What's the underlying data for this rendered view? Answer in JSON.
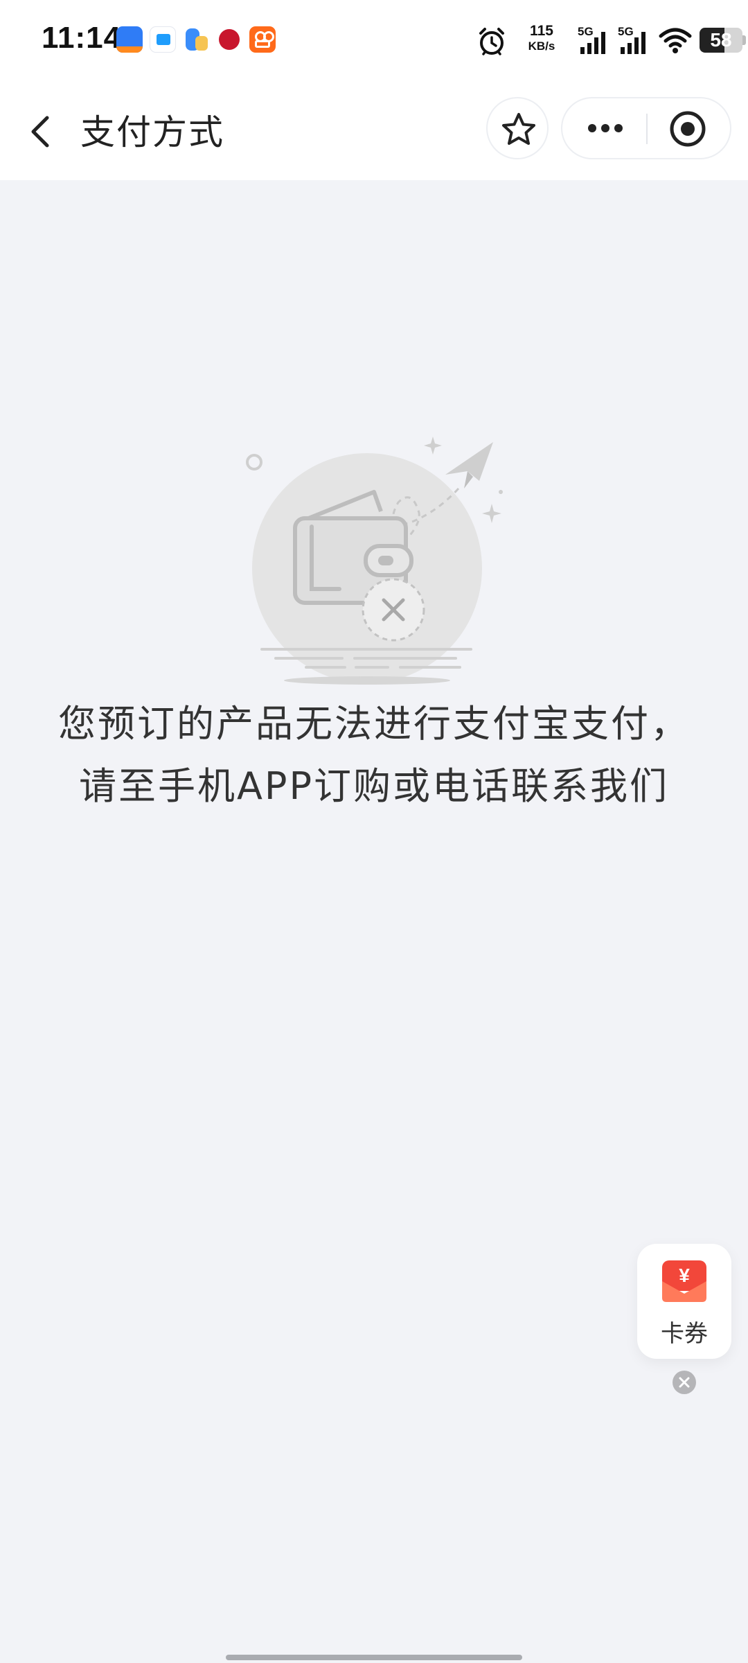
{
  "status_bar": {
    "time": "11:14",
    "net_speed_value": "115",
    "net_speed_unit": "KB/s",
    "signal_1_label": "5G",
    "signal_2_label": "5G",
    "battery_level": "58",
    "app_icons": [
      "travel-app-icon",
      "messenger-app-icon",
      "notes-app-icon",
      "bank-app-icon",
      "community-app-icon"
    ]
  },
  "nav_bar": {
    "title": "支付方式",
    "icons": [
      "back-arrow-icon",
      "star-icon",
      "more-dots-icon",
      "mini-program-close-icon"
    ]
  },
  "content": {
    "illustration": "empty-wallet-payment-failed-icon",
    "message": "您预订的产品无法进行支付宝支付，请至手机APP订购或电话联系我们"
  },
  "coupon_float": {
    "label": "卡券",
    "icon_symbol": "¥",
    "accent_color": "#f2473a"
  },
  "colors": {
    "page_background": "#f2f3f7",
    "bar_background": "#ffffff",
    "text_primary": "#333333",
    "illustration_gray": "#dcdcdc"
  }
}
